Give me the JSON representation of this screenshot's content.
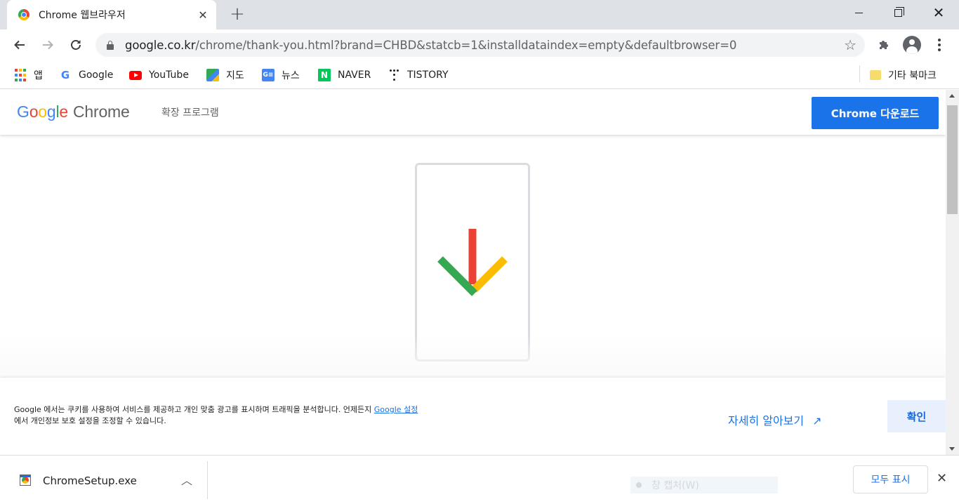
{
  "browser": {
    "tab": {
      "title": "Chrome 웹브라우저",
      "close": "✕"
    },
    "new_tab": "+",
    "window": {
      "close": "✕"
    },
    "url": {
      "host": "google.co.kr",
      "path": "/chrome/thank-you.html?brand=CHBD&statcb=1&installdataindex=empty&defaultbrowser=0"
    },
    "bookmarks": [
      {
        "label": "앱",
        "icon": "apps-icon"
      },
      {
        "label": "Google",
        "icon": "google-icon"
      },
      {
        "label": "YouTube",
        "icon": "youtube-icon"
      },
      {
        "label": "지도",
        "icon": "maps-icon"
      },
      {
        "label": "뉴스",
        "icon": "news-icon"
      },
      {
        "label": "NAVER",
        "icon": "naver-icon"
      },
      {
        "label": "TISTORY",
        "icon": "tistory-icon"
      }
    ],
    "other_bookmarks": "기타 북마크"
  },
  "page": {
    "logo": {
      "google": [
        "G",
        "o",
        "o",
        "g",
        "l",
        "e"
      ],
      "chrome": "Chrome"
    },
    "logo_colors": [
      "#4285f4",
      "#ea4335",
      "#fbbc04",
      "#4285f4",
      "#34a853",
      "#ea4335"
    ],
    "extensions_link": "확장 프로그램",
    "download_button": "Chrome 다운로드",
    "cookie": {
      "text_before": "Google 에서는 쿠키를 사용하여 서비스를 제공하고 개인 맞춤 광고를 표시하며 트래픽을 분석합니다. 언제든지 ",
      "link": "Google 설정",
      "text_after": " 에서 개인정보 보호 설정을 조정할 수 있습니다.",
      "learn_more": "자세히 알아보기",
      "learn_more_icon": "↗",
      "ok": "확인"
    },
    "arrow_colors": {
      "red": "#ea4335",
      "green": "#34a853",
      "yellow": "#fbbc04"
    }
  },
  "download_shelf": {
    "file_name": "ChromeSetup.exe",
    "ghost_text": "창 캡처(W)",
    "show_all": "모두 표시",
    "close": "✕"
  },
  "colors": {
    "accent": "#1a73e8",
    "tabstrip": "#dee1e6"
  }
}
